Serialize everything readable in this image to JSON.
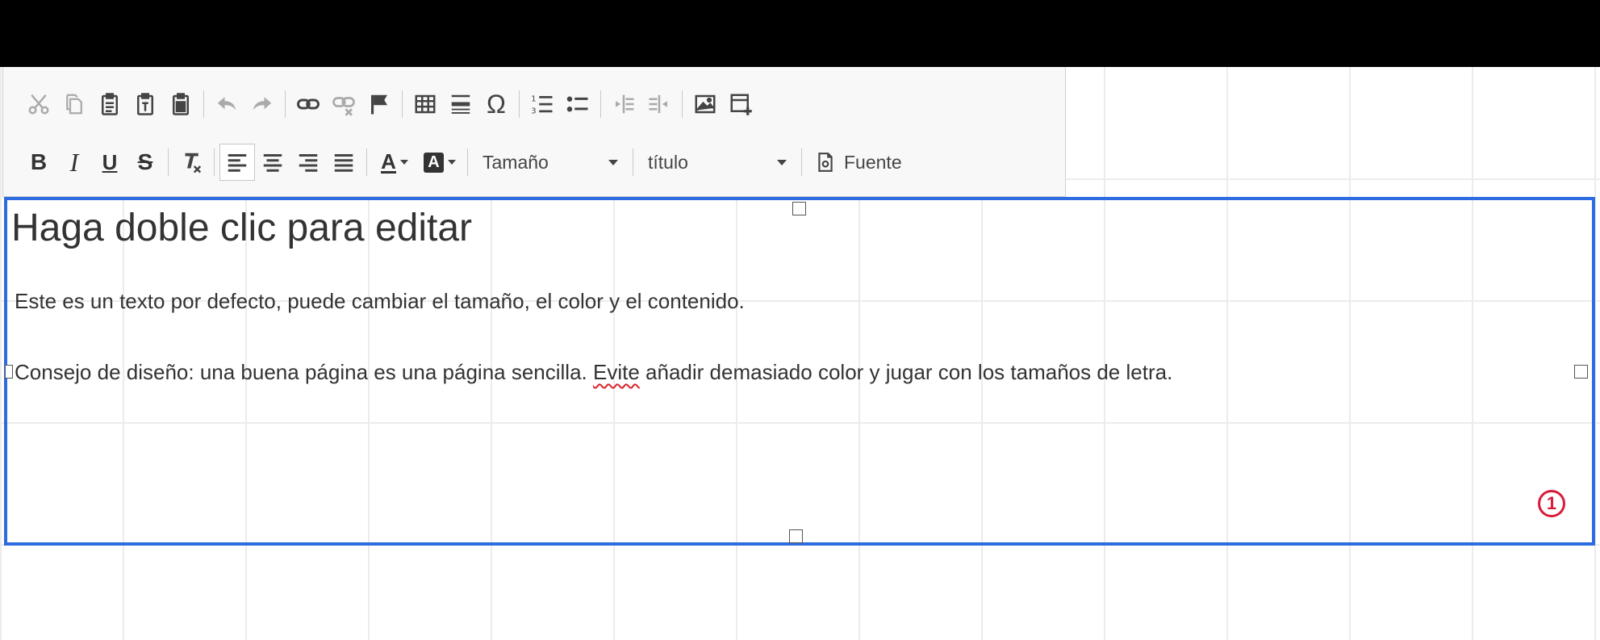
{
  "toolbar": {
    "row1": {
      "cut": "cut-icon",
      "copy": "copy-icon",
      "paste": "paste-icon",
      "paste_text": "paste-text-icon",
      "paste_word": "paste-word-icon",
      "undo": "undo-icon",
      "redo": "redo-icon",
      "link": "link-icon",
      "unlink": "unlink-icon",
      "anchor": "anchor-flag-icon",
      "table": "table-icon",
      "hr": "horizontal-rule-icon",
      "special_char": "Ω",
      "numbered_list": "numbered-list-icon",
      "bulleted_list": "bulleted-list-icon",
      "outdent": "outdent-icon",
      "indent": "indent-icon",
      "image": "image-icon",
      "insert_block": "insert-block-icon"
    },
    "row2": {
      "bold": "B",
      "italic": "I",
      "underline": "U",
      "strike": "S",
      "remove_format": "remove-format-icon",
      "size_label": "Tamaño",
      "format_label": "título",
      "source_label": "Fuente",
      "text_color_letter": "A",
      "bg_color_letter": "A"
    }
  },
  "editor": {
    "heading": "Haga doble clic para editar",
    "paragraph1": "Este es un texto por defecto, puede cambiar el tamaño, el color y el contenido.",
    "paragraph2_before": "Consejo de diseño: una buena página es una página sencilla. ",
    "paragraph2_misspelled": "Evite",
    "paragraph2_after": " añadir demasiado color y jugar con los tamaños de letra.",
    "block_number": "1"
  },
  "colors": {
    "accent_border": "#2c6be0",
    "badge": "#d81b3a",
    "spellcheck": "#d9232e"
  }
}
